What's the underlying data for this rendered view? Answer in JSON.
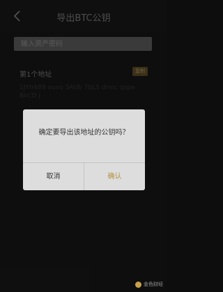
{
  "header": {
    "back_icon": "chevron-left-icon",
    "title": "导出BTC公钥"
  },
  "input": {
    "placeholder": "输入资产密码"
  },
  "address": {
    "label": "第1个地址",
    "copy_label": "复制",
    "value": "1JYtrk89 ouvo 3AUb 7bLS drmc qope 8hCD j"
  },
  "dialog": {
    "message": "确定要导出该地址的公钥吗？",
    "cancel_label": "取消",
    "confirm_label": "确认"
  },
  "watermark": {
    "text": "金色财经"
  },
  "colors": {
    "accent": "#b3923f",
    "background": "#1b1b1b",
    "dialog": "#dddddd"
  }
}
